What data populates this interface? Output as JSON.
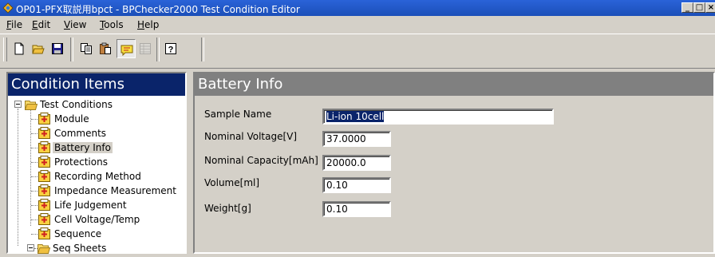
{
  "window": {
    "title": "OP01-PFX取説用bpct - BPChecker2000 Test Condition Editor",
    "minimize_glyph": "_",
    "maximize_glyph": "□",
    "close_glyph": "×"
  },
  "menu": {
    "items": [
      {
        "accel": "F",
        "rest": "ile"
      },
      {
        "accel": "E",
        "rest": "dit"
      },
      {
        "accel": "V",
        "rest": "iew"
      },
      {
        "accel": "T",
        "rest": "ools"
      },
      {
        "accel": "H",
        "rest": "elp"
      }
    ]
  },
  "toolbar": {
    "buttons": [
      "new-file-icon",
      "open-folder-icon",
      "save-disk-icon",
      "copy-icon",
      "paste-icon",
      "condition-view-icon",
      "sheet-view-icon",
      "help-icon"
    ],
    "help_glyph": "?"
  },
  "left_panel": {
    "header": "Condition Items",
    "tree": {
      "root": "Test Conditions",
      "items": [
        "Module",
        "Comments",
        "Battery Info",
        "Protections",
        "Recording Method",
        "Impedance Measurement",
        "Life Judgement",
        "Cell Voltage/Temp",
        "Sequence"
      ],
      "selected": "Battery Info",
      "next_group": "Seq Sheets"
    }
  },
  "right_panel": {
    "header": "Battery Info",
    "fields": [
      {
        "label": "Sample Name",
        "value": "Li-ion 10cell"
      },
      {
        "label": "Nominal Voltage[V]",
        "value": "37.0000"
      },
      {
        "label": "Nominal Capacity[mAh]",
        "value": "20000.0"
      },
      {
        "label": "Volume[ml]",
        "value": "0.10"
      },
      {
        "label": "Weight[g]",
        "value": "0.10"
      }
    ]
  },
  "colors": {
    "title_bar": "#1b4fb8",
    "active_header": "#0a246a",
    "inactive_header": "#808080",
    "face": "#d4d0c8"
  }
}
